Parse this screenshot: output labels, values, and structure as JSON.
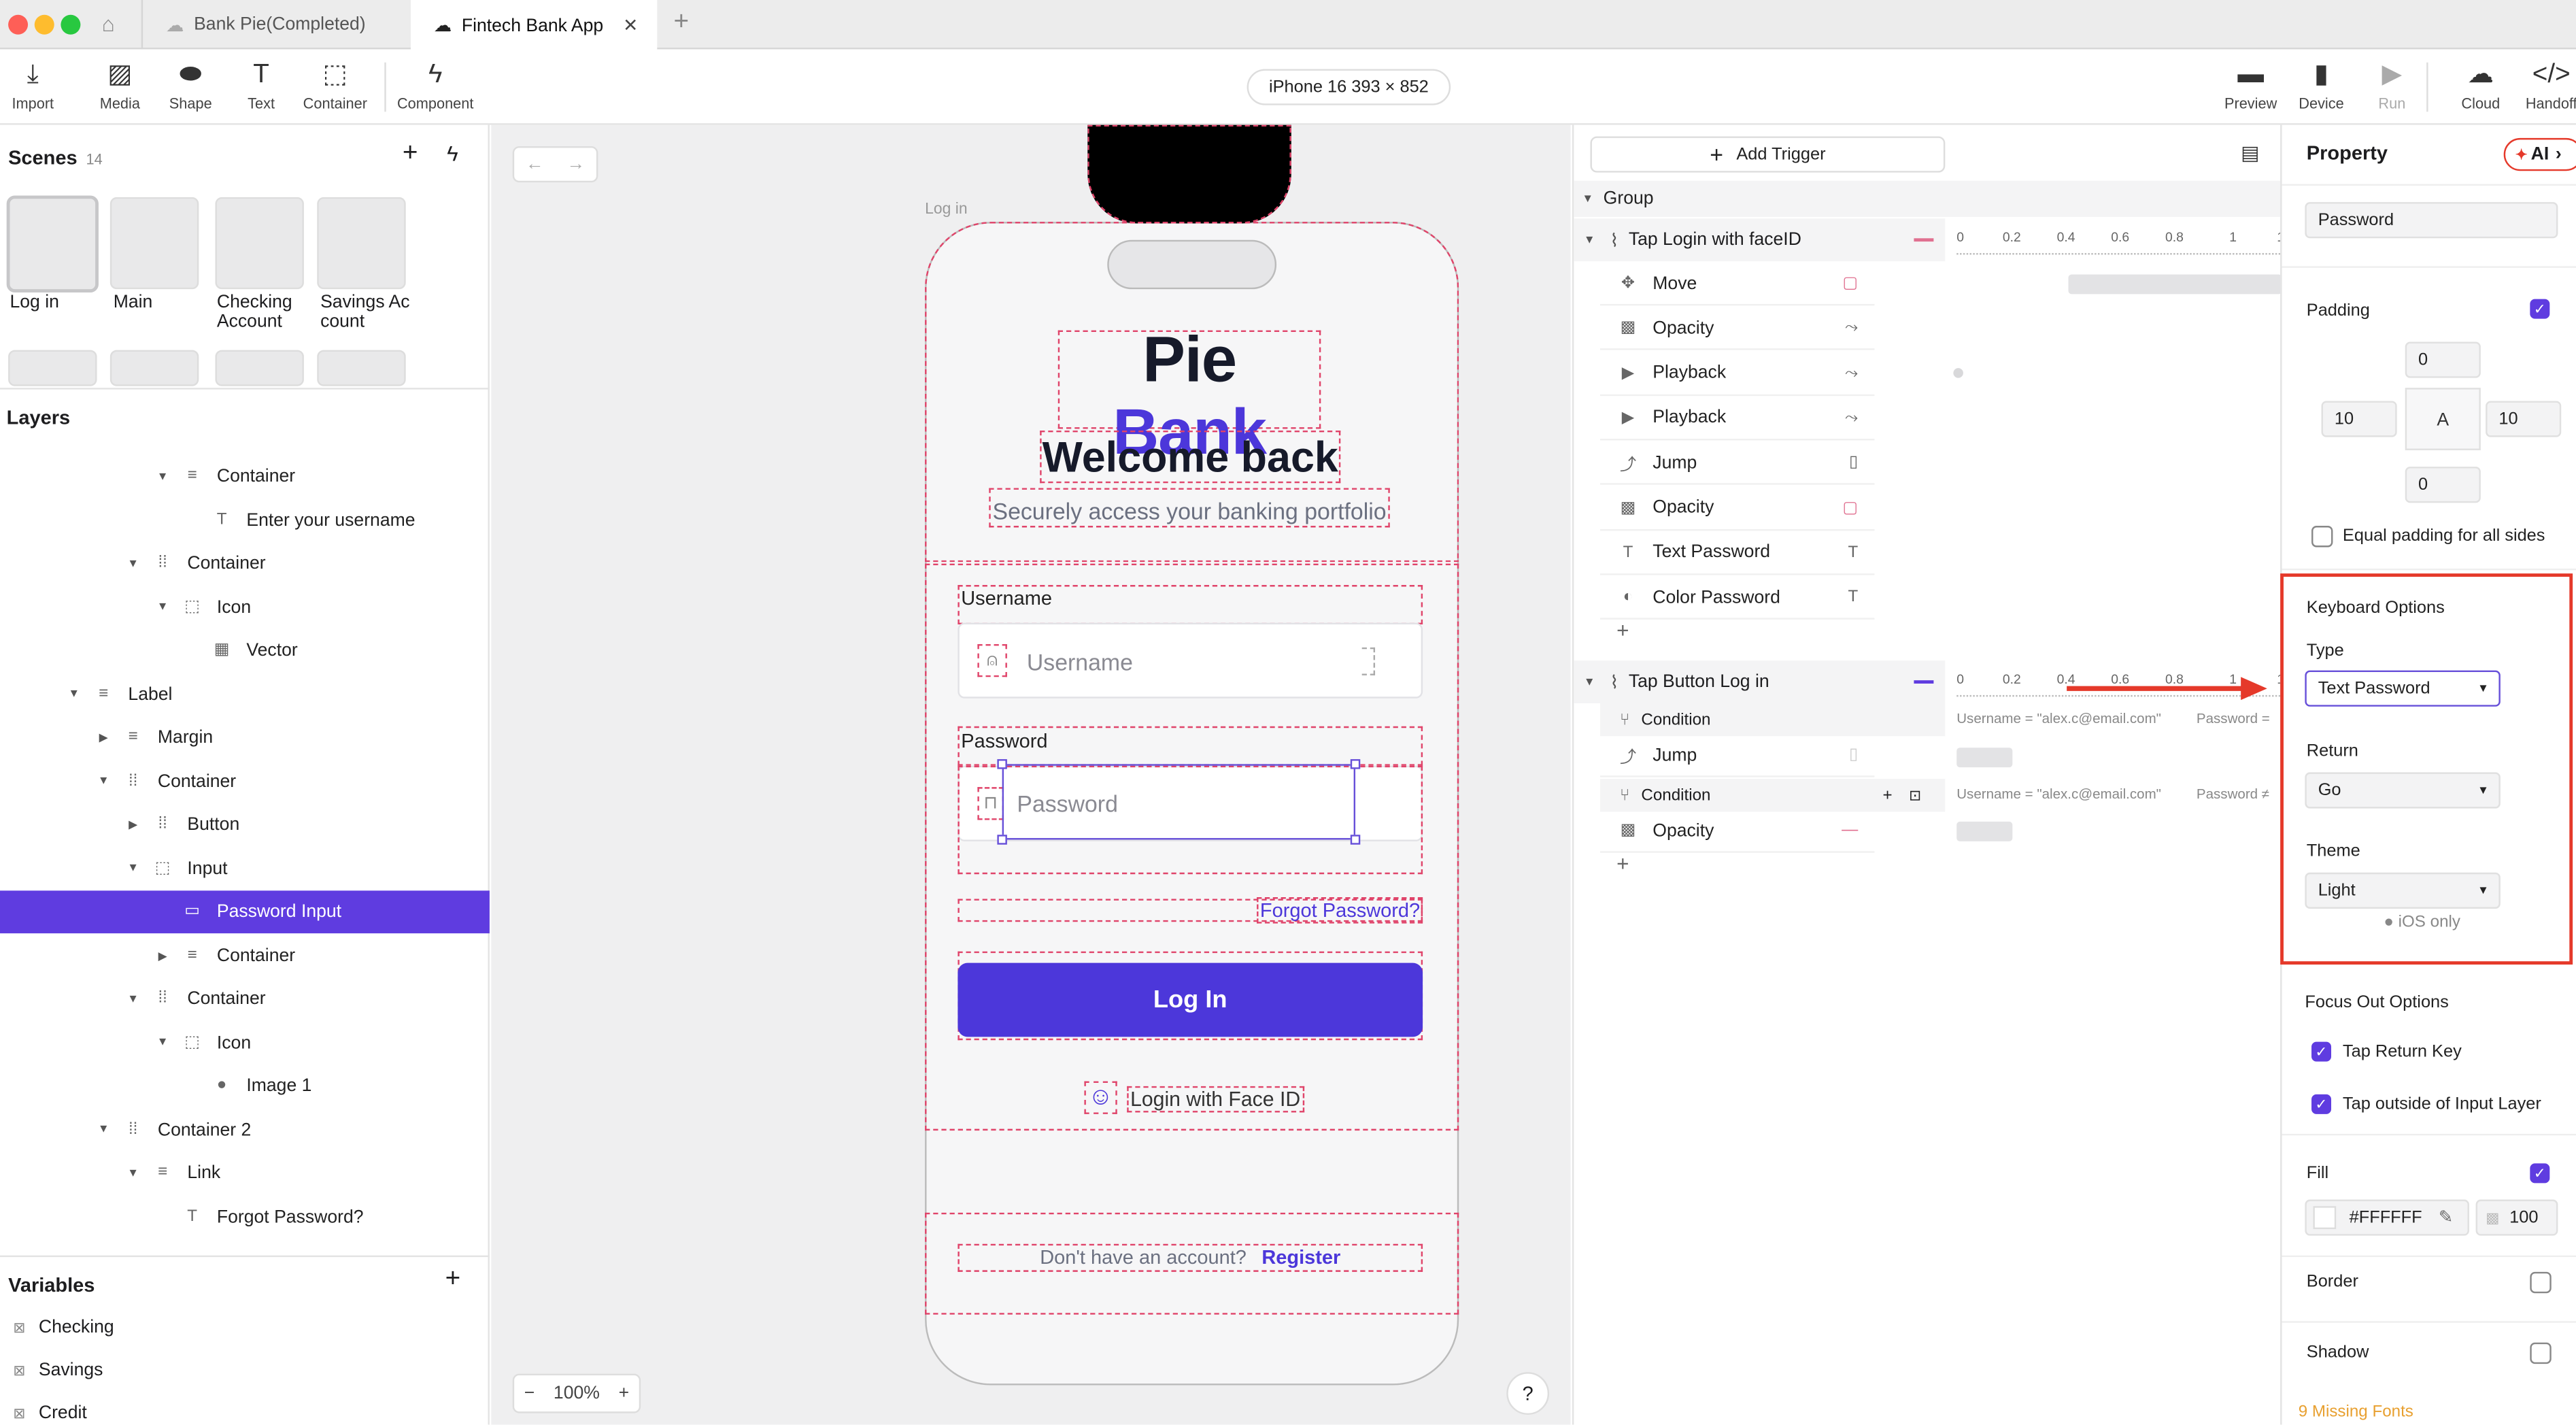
{
  "tabs": [
    {
      "label": "Bank Pie(Completed)"
    },
    {
      "label": "Fintech Bank App"
    }
  ],
  "toolbar": {
    "items": [
      "Import",
      "Media",
      "Shape",
      "Text",
      "Container",
      "Component"
    ],
    "device": "iPhone 16  393 × 852",
    "right_items": [
      "Preview",
      "Device",
      "Run",
      "Cloud",
      "Handoff"
    ]
  },
  "scenes": {
    "title": "Scenes",
    "count": "14",
    "items": [
      "Log in",
      "Main",
      "Checking Account",
      "Savings Account"
    ]
  },
  "layers": {
    "title": "Layers",
    "items": [
      {
        "label": "Container",
        "depth": 5,
        "arrow": "▼",
        "icon": "≡"
      },
      {
        "label": "Enter your username",
        "depth": 6,
        "arrow": "",
        "icon": "T"
      },
      {
        "label": "Container",
        "depth": 4,
        "arrow": "▼",
        "icon": "⁞⁞"
      },
      {
        "label": "Icon",
        "depth": 5,
        "arrow": "▼",
        "icon": "⬚"
      },
      {
        "label": "Vector",
        "depth": 6,
        "arrow": "",
        "icon": "▦"
      },
      {
        "label": "Label",
        "depth": 2,
        "arrow": "▼",
        "icon": "≡"
      },
      {
        "label": "Margin",
        "depth": 3,
        "arrow": "▶",
        "icon": "≡"
      },
      {
        "label": "Container",
        "depth": 3,
        "arrow": "▼",
        "icon": "⁞⁞"
      },
      {
        "label": "Button",
        "depth": 4,
        "arrow": "▶",
        "icon": "⁞⁞"
      },
      {
        "label": "Input",
        "depth": 4,
        "arrow": "▼",
        "icon": "⬚"
      },
      {
        "label": "Password Input",
        "depth": 5,
        "arrow": "",
        "icon": "▭"
      },
      {
        "label": "Container",
        "depth": 5,
        "arrow": "▶",
        "icon": "≡"
      },
      {
        "label": "Container",
        "depth": 4,
        "arrow": "▼",
        "icon": "⁞⁞"
      },
      {
        "label": "Icon",
        "depth": 5,
        "arrow": "▼",
        "icon": "⬚"
      },
      {
        "label": "Image 1",
        "depth": 6,
        "arrow": "",
        "icon": "●"
      },
      {
        "label": "Container 2",
        "depth": 3,
        "arrow": "▼",
        "icon": "⁞⁞"
      },
      {
        "label": "Link",
        "depth": 4,
        "arrow": "▼",
        "icon": "≡"
      },
      {
        "label": "Forgot Password?",
        "depth": 5,
        "arrow": "",
        "icon": "T"
      }
    ]
  },
  "variables": {
    "title": "Variables",
    "items": [
      "Checking",
      "Savings",
      "Credit"
    ]
  },
  "canvas": {
    "frame_label": "Log in",
    "brand_a": "Pie",
    "brand_b": "Bank",
    "welcome": "Welcome back",
    "subtitle": "Securely access your banking portfolio",
    "username_label": "Username",
    "username_placeholder": "Username",
    "password_label": "Password",
    "password_placeholder": "Password",
    "forgot": "Forgot Password?",
    "login_button": "Log In",
    "faceid": "Login with Face ID",
    "no_account": "Don't have an account?",
    "register": "Register",
    "zoom": "100%"
  },
  "timeline": {
    "add_trigger": "Add Trigger",
    "group": "Group",
    "trigger1": "Tap Login with faceID",
    "actions1": [
      "Move",
      "Opacity",
      "Playback",
      "Playback",
      "Jump",
      "Opacity",
      "Text Password",
      "Color Password"
    ],
    "trigger2": "Tap Button Log in",
    "condition": "Condition",
    "cond_text1": "Username = \"alex.c@email.com\"",
    "cond_text1b": "Password =",
    "cond_text2": "Username = \"alex.c@email.com\"",
    "cond_text2b": "Password ≠",
    "action_jump": "Jump",
    "action_opacity": "Opacity",
    "ruler": [
      "0",
      "0.2",
      "0.4",
      "0.6",
      "0.8",
      "1",
      "1"
    ]
  },
  "property": {
    "title": "Property",
    "ai": "AI",
    "name": "Password",
    "padding_label": "Padding",
    "pad_top": "0",
    "pad_left": "10",
    "pad_right": "10",
    "pad_bottom": "0",
    "pad_center": "A",
    "equal_padding": "Equal padding for all sides",
    "keyboard_options": "Keyboard Options",
    "type_label": "Type",
    "type_value": "Text Password",
    "return_label": "Return",
    "return_value": "Go",
    "theme_label": "Theme",
    "theme_value": "Light",
    "ios_only": "iOS only",
    "focus_out": "Focus Out Options",
    "tap_return": "Tap Return Key",
    "tap_outside": "Tap outside of Input Layer",
    "fill_label": "Fill",
    "fill_hex": "#FFFFFF",
    "fill_opacity": "100",
    "border_label": "Border",
    "shadow_label": "Shadow",
    "missing_fonts": "9 Missing Fonts"
  },
  "colors": {
    "accent": "#5f3ce0",
    "highlight": "#e5392a",
    "selection": "#e0446a"
  }
}
